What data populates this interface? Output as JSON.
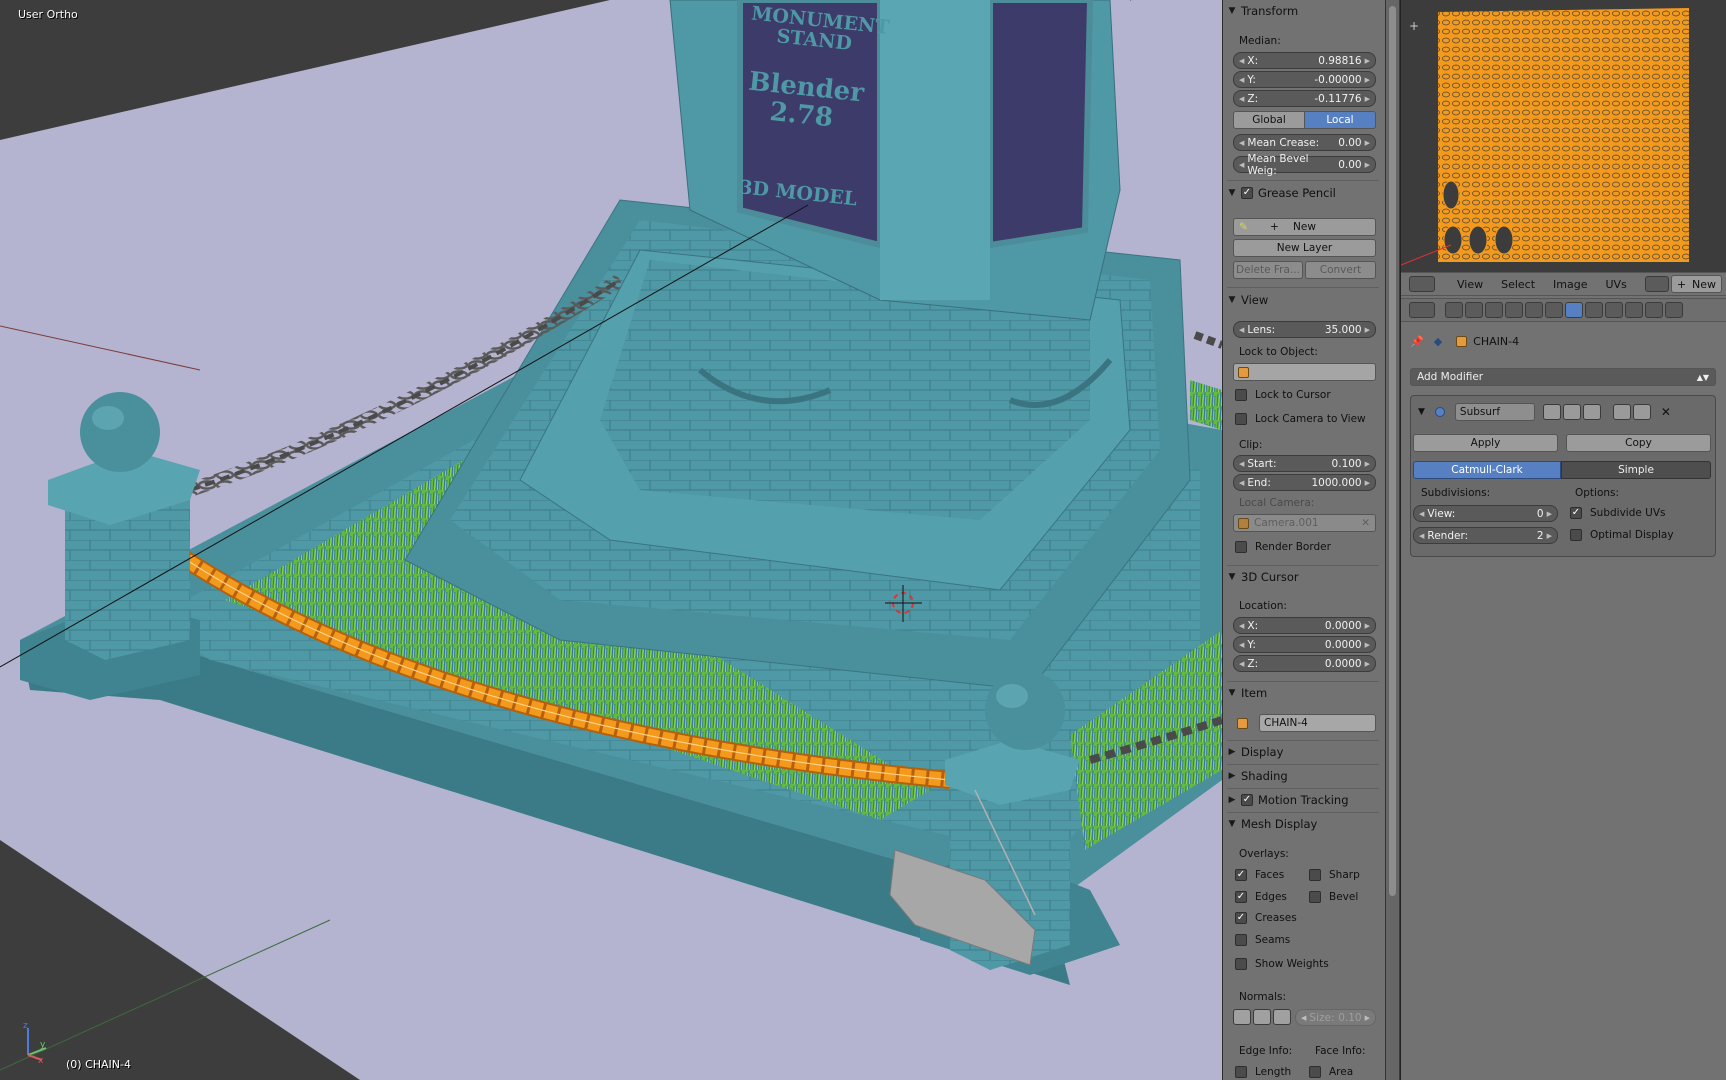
{
  "viewport": {
    "view_label": "User Ortho",
    "object_label": "(0) CHAIN-4",
    "plaque_text": [
      "MONUMENT",
      "STAND",
      "Blender",
      "2.78",
      "3D MODEL"
    ]
  },
  "npanel": {
    "transform": {
      "title": "Transform",
      "median_label": "Median:",
      "x_label": "X:",
      "x_value": "0.98816",
      "y_label": "Y:",
      "y_value": "-0.00000",
      "z_label": "Z:",
      "z_value": "-0.11776",
      "global_label": "Global",
      "local_label": "Local",
      "crease_label": "Mean Crease:",
      "crease_value": "0.00",
      "bevel_label": "Mean Bevel Weig:",
      "bevel_value": "0.00"
    },
    "grease_pencil": {
      "title": "Grease Pencil",
      "enabled": true,
      "new_label": "New",
      "new_layer_label": "New Layer",
      "delete_frame_label": "Delete Fra...",
      "convert_label": "Convert"
    },
    "view": {
      "title": "View",
      "lens_label": "Lens:",
      "lens_value": "35.000",
      "lock_to_object_label": "Lock to Object:",
      "lock_to_cursor_label": "Lock to Cursor",
      "lock_camera_label": "Lock Camera to View",
      "clip_label": "Clip:",
      "start_label": "Start:",
      "start_value": "0.100",
      "end_label": "End:",
      "end_value": "1000.000",
      "local_camera_label": "Local Camera:",
      "local_camera_value": "Camera.001",
      "render_border_label": "Render Border"
    },
    "cursor": {
      "title": "3D Cursor",
      "location_label": "Location:",
      "x_label": "X:",
      "x_value": "0.0000",
      "y_label": "Y:",
      "y_value": "0.0000",
      "z_label": "Z:",
      "z_value": "0.0000"
    },
    "item": {
      "title": "Item",
      "name": "CHAIN-4"
    },
    "collapsed": {
      "display": "Display",
      "shading": "Shading",
      "motion_tracking": "Motion Tracking"
    },
    "mesh_display": {
      "title": "Mesh Display",
      "overlays_label": "Overlays:",
      "faces": "Faces",
      "faces_on": true,
      "sharp": "Sharp",
      "sharp_on": false,
      "edges": "Edges",
      "edges_on": true,
      "bevel": "Bevel",
      "bevel_on": false,
      "creases": "Creases",
      "creases_on": true,
      "seams": "Seams",
      "seams_on": false,
      "show_weights": "Show Weights",
      "show_weights_on": false,
      "normals_label": "Normals:",
      "size_label": "Size:",
      "size_value": "0.10",
      "edge_info_label": "Edge Info:",
      "face_info_label": "Face Info:",
      "length": "Length",
      "area": "Area"
    }
  },
  "uv_header": {
    "menus": [
      "View",
      "Select",
      "Image",
      "UVs"
    ],
    "new_label": "New"
  },
  "properties": {
    "object_name": "CHAIN-4",
    "add_modifier_label": "Add Modifier",
    "modifier_name": "Subsurf",
    "apply_label": "Apply",
    "copy_label": "Copy",
    "catmull_label": "Catmull-Clark",
    "simple_label": "Simple",
    "subdivisions_label": "Subdivisions:",
    "options_label": "Options:",
    "view_label": "View:",
    "view_value": "0",
    "render_label": "Render:",
    "render_value": "2",
    "subdivide_uvs_label": "Subdivide UVs",
    "optimal_display_label": "Optimal Display"
  },
  "colors": {
    "accent_blue": "#5680c2",
    "selection_orange": "#f0901c",
    "mesh_teal": "#4a8f9c",
    "grass_green": "#5fb63a",
    "ground_lavender": "#b2b2cf"
  }
}
